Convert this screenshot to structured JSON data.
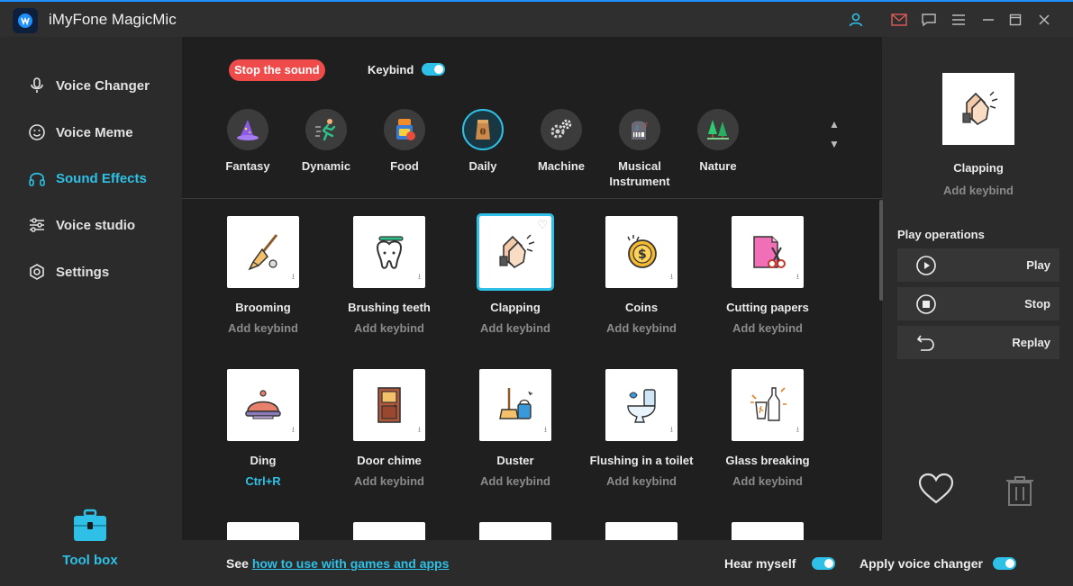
{
  "app": {
    "title": "iMyFone MagicMic"
  },
  "titlebar": {
    "icons": [
      "user-icon",
      "mail-icon",
      "chat-icon",
      "menu-icon",
      "minimize-icon",
      "maximize-icon",
      "close-icon"
    ]
  },
  "sidebar": {
    "items": [
      {
        "label": "Voice Changer",
        "icon": "microphone-icon",
        "active": false
      },
      {
        "label": "Voice Meme",
        "icon": "smiley-icon",
        "active": false
      },
      {
        "label": "Sound Effects",
        "icon": "headphones-icon",
        "active": true
      },
      {
        "label": "Voice studio",
        "icon": "sliders-icon",
        "active": false
      },
      {
        "label": "Settings",
        "icon": "gear-icon",
        "active": false
      }
    ],
    "toolbox_label": "Tool box"
  },
  "main": {
    "stop_label": "Stop the sound",
    "keybind_label": "Keybind",
    "keybind_on": true,
    "categories": [
      {
        "label": "Fantasy",
        "active": false
      },
      {
        "label": "Dynamic",
        "active": false
      },
      {
        "label": "Food",
        "active": false
      },
      {
        "label": "Daily",
        "active": true
      },
      {
        "label": "Machine",
        "active": false
      },
      {
        "label": "Musical Instrument",
        "active": false
      },
      {
        "label": "Nature",
        "active": false
      }
    ],
    "sounds": [
      {
        "name": "Brooming",
        "keybind": "Add keybind",
        "icon": "broom-icon"
      },
      {
        "name": "Brushing teeth",
        "keybind": "Add keybind",
        "icon": "tooth-icon"
      },
      {
        "name": "Clapping",
        "keybind": "Add keybind",
        "icon": "clapping-icon",
        "selected": true
      },
      {
        "name": "Coins",
        "keybind": "Add keybind",
        "icon": "coin-icon"
      },
      {
        "name": "Cutting papers",
        "keybind": "Add keybind",
        "icon": "scissors-icon"
      },
      {
        "name": "Ding",
        "keybind": "Ctrl+R",
        "icon": "bell-icon",
        "keybind_set": true
      },
      {
        "name": "Door chime",
        "keybind": "Add keybind",
        "icon": "door-icon"
      },
      {
        "name": "Duster",
        "keybind": "Add keybind",
        "icon": "duster-icon"
      },
      {
        "name": "Flushing in a toilet",
        "keybind": "Add keybind",
        "icon": "toilet-icon"
      },
      {
        "name": "Glass breaking",
        "keybind": "Add keybind",
        "icon": "glass-icon"
      }
    ]
  },
  "right_panel": {
    "selected_name": "Clapping",
    "selected_keybind": "Add keybind",
    "play_ops_title": "Play operations",
    "ops": [
      "Play",
      "Stop",
      "Replay"
    ]
  },
  "bottom": {
    "see_prefix": "See ",
    "link_text": "how to use with games and apps",
    "hear_myself": "Hear myself",
    "apply_changer": "Apply voice changer",
    "hear_myself_on": true,
    "apply_changer_on": true
  },
  "colors": {
    "accent": "#2ec0e6",
    "danger": "#ef4b4b",
    "bg": "#2b2b2b",
    "content_bg": "#1f1f1f"
  }
}
